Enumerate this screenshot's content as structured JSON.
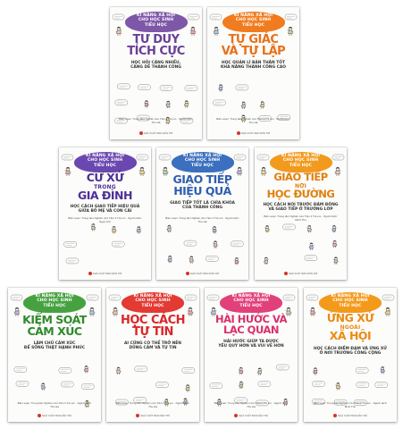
{
  "series": {
    "banner_lines": [
      "KĨ NĂNG XÃ HỘI",
      "CHO HỌC SINH",
      "TIỂU HỌC"
    ]
  },
  "books": [
    {
      "key": "tu-duy-tich-cuc",
      "banner_color": "#7e57a8",
      "title_color": "#6a3f98",
      "title_lines": [
        {
          "text": "TƯ DUY",
          "small": false
        },
        {
          "text": "TÍCH CỰC",
          "small": false
        }
      ],
      "subtitle_lines": [
        "HỌC HỎI CÀNG NHIỀU,",
        "CÀNG DỄ THÀNH CÔNG"
      ],
      "credits": "Biên soạn: Trung tâm Nghiên cứu Tâm lí Trẻ em · Người dịch: Thu Hà",
      "publisher": "NHÀ XUẤT BẢN DÂN TRÍ"
    },
    {
      "key": "tu-giac-va-tu-lap",
      "banner_color": "#f07c1f",
      "title_color": "#e8701a",
      "title_lines": [
        {
          "text": "TỰ GIÁC",
          "small": false
        },
        {
          "text": "VÀ TỰ LẬP",
          "small": false
        }
      ],
      "subtitle_lines": [
        "HỌC QUẢN LÍ BẢN THÂN TỐT",
        "KHẢ NĂNG THÀNH CÔNG CAO"
      ],
      "credits": "Biên soạn: Trung tâm Nghiên cứu Tâm lí Trẻ em · Người dịch: Thu Hà",
      "publisher": "NHÀ XUẤT BẢN DÂN TRÍ"
    },
    {
      "key": "cu-xu-trong-gia-dinh",
      "banner_color": "#6a48b0",
      "title_color": "#4e2f9a",
      "title_lines": [
        {
          "text": "CƯ XỬ",
          "small": false
        },
        {
          "text": "TRONG",
          "small": true
        },
        {
          "text": "GIA ĐÌNH",
          "small": false
        }
      ],
      "subtitle_lines": [
        "HỌC CÁCH GIAO TIẾP HIỆU QUẢ",
        "GIỮA BỐ MẸ VÀ CON CÁI"
      ],
      "credits": "Biên soạn: Trung tâm Nghiên cứu Tâm lí Trẻ em · Người dịch: Ngọc Anh",
      "publisher": "NHÀ XUẤT BẢN DÂN TRÍ"
    },
    {
      "key": "giao-tiep-hieu-qua",
      "banner_color": "#3b6fbf",
      "title_color": "#2f5fb0",
      "title_lines": [
        {
          "text": "GIAO TIẾP",
          "small": false
        },
        {
          "text": "HIỆU QUẢ",
          "small": false
        }
      ],
      "subtitle_lines": [
        "GIAO TIẾP TỐT LÀ CHÌA KHÓA",
        "CỦA THÀNH CÔNG"
      ],
      "credits": "Biên soạn: Trung tâm Nghiên cứu Tâm lí Trẻ em · Người dịch: Thu Hà",
      "publisher": "NHÀ XUẤT BẢN DÂN TRÍ"
    },
    {
      "key": "giao-tiep-noi-hoc-duong",
      "banner_color": "#f29a1e",
      "title_color": "#e0800f",
      "title_lines": [
        {
          "text": "GIAO TIẾP",
          "small": false
        },
        {
          "text": "NƠI",
          "small": true
        },
        {
          "text": "HỌC ĐƯỜNG",
          "small": false
        }
      ],
      "subtitle_lines": [
        "HỌC CÁCH NÓI TRƯỚC ĐÁM ĐÔNG",
        "VÀ GIAO TIẾP Ở TRƯỜNG LỚP"
      ],
      "credits": "Biên soạn: Trung tâm Nghiên cứu Tâm lí Trẻ em · Người dịch: Minh Thu",
      "publisher": "NHÀ XUẤT BẢN DÂN TRÍ"
    },
    {
      "key": "kiem-soat-cam-xuc",
      "banner_color": "#46a241",
      "title_color": "#2f8a2c",
      "title_lines": [
        {
          "text": "KIỂM SOÁT",
          "small": false
        },
        {
          "text": "CẢM XÚC",
          "small": false
        }
      ],
      "subtitle_lines": [
        "LÀM CHỦ CẢM XÚC",
        "ĐỂ SỐNG THẬT HẠNH PHÚC"
      ],
      "credits": "Biên soạn: Trung tâm Nghiên cứu Tâm lí Trẻ em · Người dịch: Thu Hà",
      "publisher": "NHÀ XUẤT BẢN DÂN TRÍ"
    },
    {
      "key": "hoc-cach-tu-tin",
      "banner_color": "#e33a33",
      "title_color": "#d9272a",
      "title_lines": [
        {
          "text": "HỌC CÁCH",
          "small": false
        },
        {
          "text": "TỰ TIN",
          "small": false
        }
      ],
      "subtitle_lines": [
        "AI CŨNG CÓ THỂ TRỞ NÊN",
        "DŨNG CẢM VÀ TỰ TIN"
      ],
      "credits": "Biên soạn: Trung tâm Nghiên cứu Tâm lí Trẻ em · Người dịch: Thu Hà",
      "publisher": "NHÀ XUẤT BẢN DÂN TRÍ"
    },
    {
      "key": "hai-huoc-va-lac-quan",
      "banner_color": "#e2407a",
      "title_color": "#d92f6e",
      "title_lines": [
        {
          "text": "HÀI HƯỚC VÀ",
          "small": false
        },
        {
          "text": "LẠC QUAN",
          "small": false
        }
      ],
      "subtitle_lines": [
        "HÀI HƯỚC GIÚP TA ĐƯỢC",
        "YÊU QUÝ HƠN VÀ VUI VẺ HƠN"
      ],
      "credits": "Biên soạn: Trung tâm Nghiên cứu Tâm lí Trẻ em · Người dịch: Thu Hà",
      "publisher": "NHÀ XUẤT BẢN DÂN TRÍ"
    },
    {
      "key": "ung-xu-ngoai-xa-hoi",
      "banner_color": "#f39a1b",
      "title_color": "#ec8a12",
      "title_lines": [
        {
          "text": "ỨNG XỬ",
          "small": false
        },
        {
          "text": "NGOÀI",
          "small": true
        },
        {
          "text": "XÃ HỘI",
          "small": false
        }
      ],
      "subtitle_lines": [
        "HỌC CÁCH ĐIỀM ĐẠM VÀ ỨNG XỬ",
        "Ở NƠI TRƯỜNG CÔNG CỘNG"
      ],
      "credits": "Biên soạn: Trung tâm Nghiên cứu Tâm lí Trẻ em · Người dịch: Minh Thu",
      "publisher": "NHÀ XUẤT BẢN DÂN TRÍ"
    }
  ]
}
